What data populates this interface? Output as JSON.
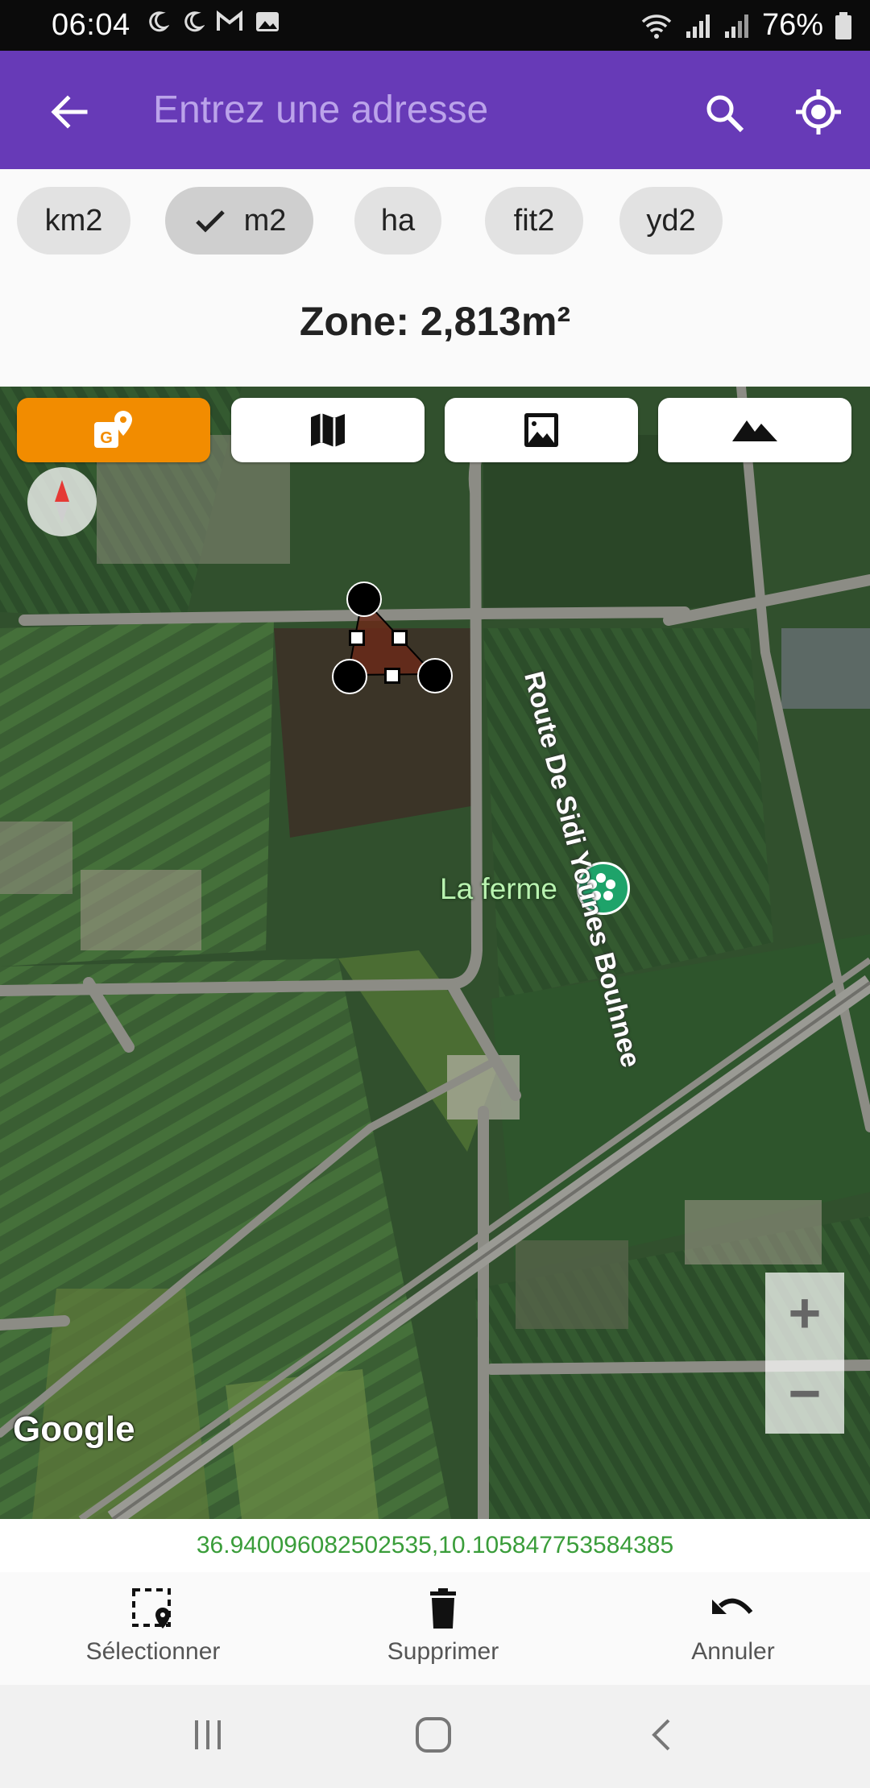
{
  "status_bar": {
    "time": "06:04",
    "battery": "76%"
  },
  "app_bar": {
    "search_placeholder": "Entrez une adresse",
    "back_icon": "arrow-left-icon",
    "search_icon": "search-icon",
    "locate_icon": "my-location-icon",
    "color": "#673ab7"
  },
  "units": {
    "options": [
      "km2",
      "m2",
      "ha",
      "fit2",
      "yd2"
    ],
    "selected": "m2"
  },
  "zone": {
    "text": "Zone: 2,813m²"
  },
  "map": {
    "map_types": [
      "geo-map-icon",
      "map-icon",
      "satellite-image-icon",
      "terrain-icon"
    ],
    "active_map_type": "geo-map-icon",
    "active_color": "#f28c00",
    "poi_label": "La ferme",
    "road_label": "Route De Sidi Younes Bouhnee",
    "zoom_in": "+",
    "zoom_out": "−",
    "attribution": "Google"
  },
  "coordinates": "36.940096082502535,10.105847753584385",
  "actions": [
    {
      "label": "Sélectionner",
      "icon": "select-area-icon"
    },
    {
      "label": "Supprimer",
      "icon": "trash-icon"
    },
    {
      "label": "Annuler",
      "icon": "undo-icon"
    }
  ]
}
